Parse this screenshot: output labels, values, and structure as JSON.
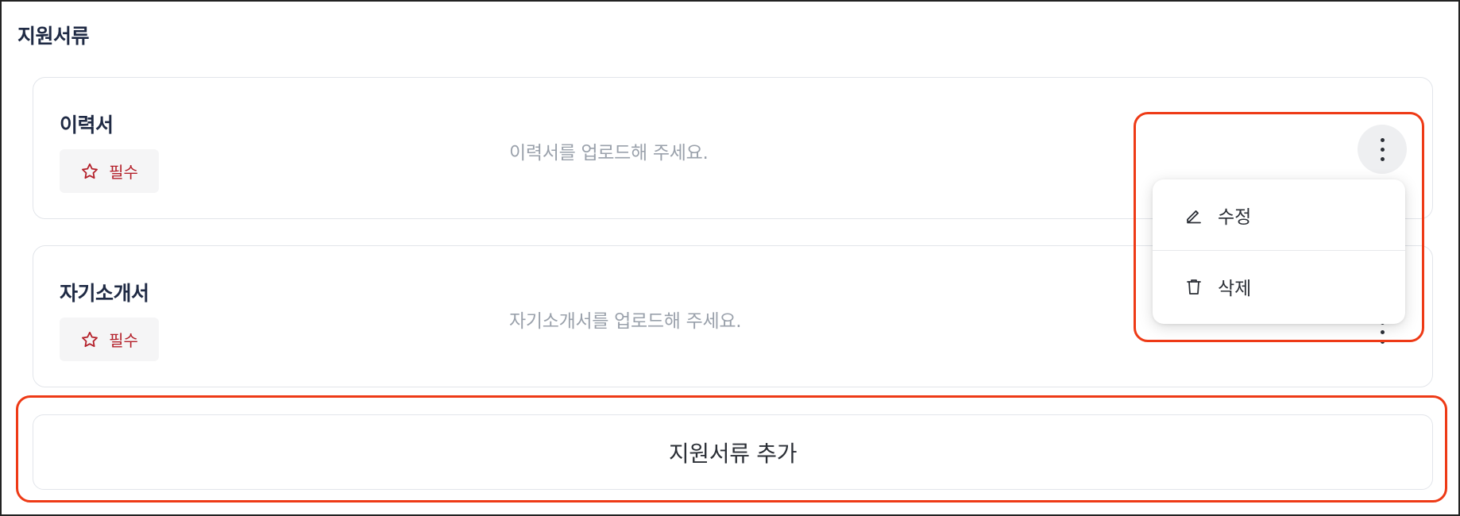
{
  "section": {
    "title": "지원서류"
  },
  "documents": [
    {
      "name": "이력서",
      "required_label": "필수",
      "hint": "이력서를 업로드해 주세요."
    },
    {
      "name": "자기소개서",
      "required_label": "필수",
      "hint": "자기소개서를 업로드해 주세요."
    }
  ],
  "menu": {
    "edit_label": "수정",
    "delete_label": "삭제"
  },
  "add_button": {
    "label": "지원서류 추가"
  },
  "icons": {
    "required": "star-icon",
    "more": "more-vertical-icon",
    "edit": "pencil-icon",
    "delete": "trash-icon"
  },
  "colors": {
    "required_text": "#b4202a",
    "highlight": "#ee3a16",
    "title_text": "#1f2a44",
    "hint_text": "#9aa1ab"
  }
}
